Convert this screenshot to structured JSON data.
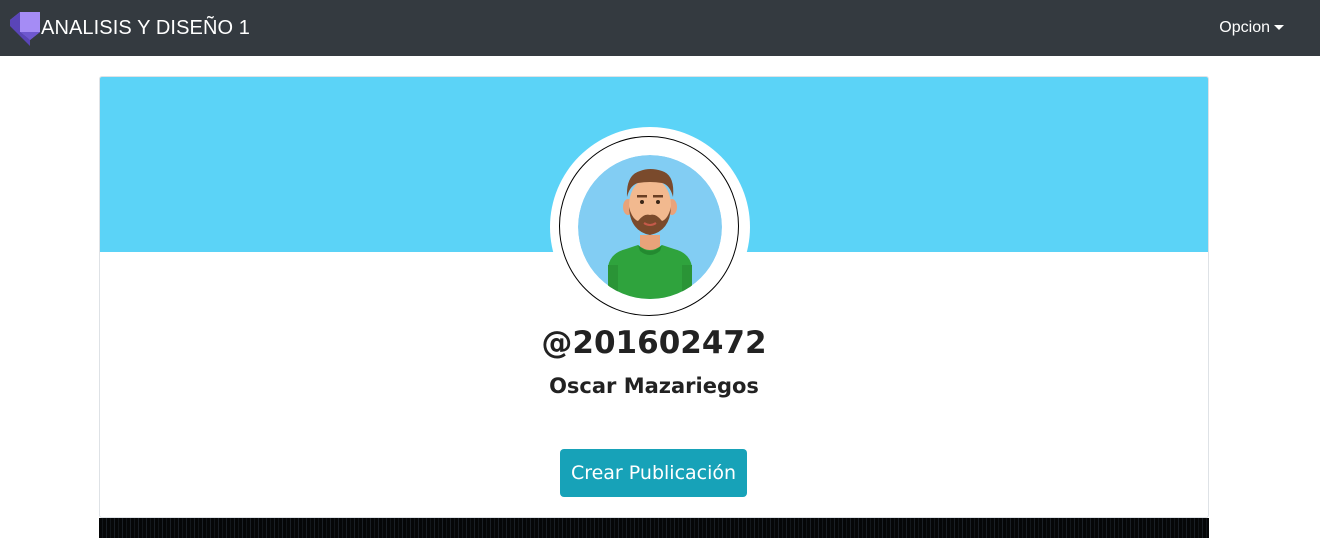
{
  "navbar": {
    "brand_title": "ANALISIS Y DISEÑO 1",
    "logo_icon": "purple-cube-logo-icon",
    "dropdown_label": "Opcion",
    "dropdown_icon": "caret-down-icon",
    "background_color": "#343a40"
  },
  "profile": {
    "banner_color": "#5bd3f7",
    "avatar_icon": "bearded-man-avatar-icon",
    "username": "@201602472",
    "full_name": "Oscar Mazariegos",
    "create_post_label": "Crear Publicación",
    "button_color": "#17a2b8"
  }
}
